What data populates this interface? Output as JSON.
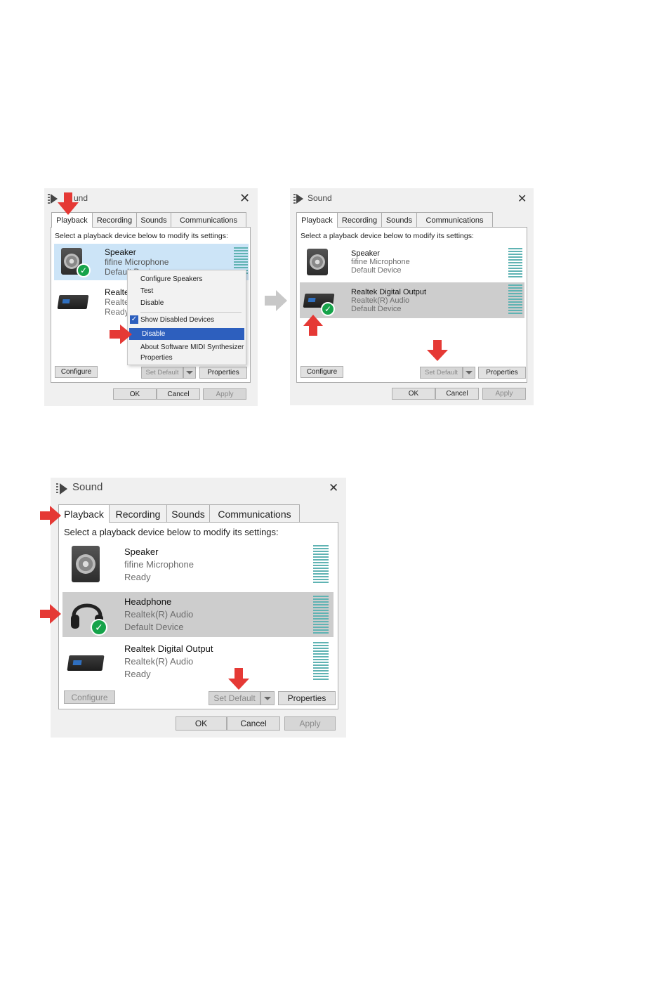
{
  "colors": {
    "accent_red": "#e53935",
    "selection_blue": "#cce4f7",
    "selection_gray": "#cdcdcd",
    "menu_highlight": "#2d5fbe",
    "meter": "#5fb3b3",
    "check_green": "#16a34a",
    "step_arrow": "#c8c8c8"
  },
  "step1": {
    "title": "Sound",
    "title_visible": "und",
    "tabs": [
      {
        "label": "Playback",
        "active": true
      },
      {
        "label": "Recording"
      },
      {
        "label": "Sounds"
      },
      {
        "label": "Communications"
      }
    ],
    "instruction": "Select a playback device below to modify its settings:",
    "devices": [
      {
        "name": "Speaker",
        "line1": "fifine Microphone",
        "line2": "Default Devi",
        "icon": "speaker-icon",
        "default": true
      },
      {
        "name": "Realte",
        "line1": "Realte",
        "line2": "Ready",
        "icon": "digital-output-icon"
      }
    ],
    "context_menu": {
      "items": [
        "Configure Speakers",
        "Test",
        "Disable",
        "Show Disabled Devices",
        "Disable",
        "About Software MIDI Synthesizer",
        "Properties"
      ],
      "checked_item": "Show Disabled Devices",
      "highlighted_item": "Disable"
    },
    "buttons": {
      "configure": "Configure",
      "set_default": "Set Default",
      "properties": "Properties",
      "ok": "OK",
      "cancel": "Cancel",
      "apply": "Apply"
    }
  },
  "step2": {
    "title": "Sound",
    "tabs": [
      {
        "label": "Playback",
        "active": true
      },
      {
        "label": "Recording"
      },
      {
        "label": "Sounds"
      },
      {
        "label": "Communications"
      }
    ],
    "instruction": "Select a playback device below to modify its settings:",
    "devices": [
      {
        "name": "Speaker",
        "line1": "fifine Microphone",
        "line2": "Default Device",
        "icon": "speaker-icon"
      },
      {
        "name": "Realtek Digital Output",
        "line1": "Realtek(R) Audio",
        "line2": "Default Device",
        "icon": "digital-output-icon",
        "default": true,
        "selected": true
      }
    ],
    "buttons": {
      "configure": "Configure",
      "set_default": "Set Default",
      "properties": "Properties",
      "ok": "OK",
      "cancel": "Cancel",
      "apply": "Apply"
    }
  },
  "step3": {
    "title": "Sound",
    "tabs": [
      {
        "label": "Playback",
        "active": true
      },
      {
        "label": "Recording"
      },
      {
        "label": "Sounds"
      },
      {
        "label": "Communications"
      }
    ],
    "instruction": "Select a playback device below to modify its settings:",
    "devices": [
      {
        "name": "Speaker",
        "line1": "fifine Microphone",
        "line2": "Ready",
        "icon": "speaker-icon"
      },
      {
        "name": "Headphone",
        "line1": "Realtek(R) Audio",
        "line2": "Default Device",
        "icon": "headphone-icon",
        "default": true,
        "selected": true
      },
      {
        "name": "Realtek Digital Output",
        "line1": "Realtek(R) Audio",
        "line2": "Ready",
        "icon": "digital-output-icon"
      }
    ],
    "buttons": {
      "configure": "Configure",
      "set_default": "Set Default",
      "properties": "Properties",
      "ok": "OK",
      "cancel": "Cancel",
      "apply": "Apply"
    }
  }
}
